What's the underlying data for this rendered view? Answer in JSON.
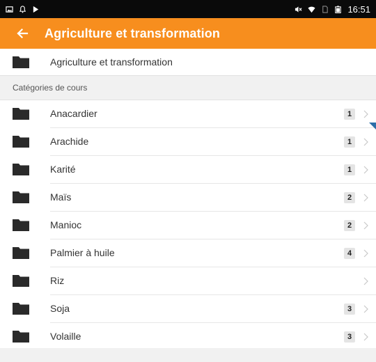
{
  "status_bar": {
    "time": "16:51",
    "icons": [
      "image-icon",
      "notification-icon",
      "play-store-icon",
      "volume-muted-icon",
      "wifi-icon",
      "sim-icon",
      "battery-icon"
    ]
  },
  "app_bar": {
    "title": "Agriculture et transformation",
    "back_icon": "arrow-left-icon",
    "background": "#f78e1e"
  },
  "parent_category": {
    "label": "Agriculture et transformation",
    "icon": "folder-icon"
  },
  "section": {
    "header": "Catégories de cours"
  },
  "categories": [
    {
      "label": "Anacardier",
      "count": "1"
    },
    {
      "label": "Arachide",
      "count": "1"
    },
    {
      "label": "Karité",
      "count": "1"
    },
    {
      "label": "Maïs",
      "count": "2"
    },
    {
      "label": "Manioc",
      "count": "2"
    },
    {
      "label": "Palmier à huile",
      "count": "4"
    },
    {
      "label": "Riz",
      "count": ""
    },
    {
      "label": "Soja",
      "count": "3"
    },
    {
      "label": "Volaille",
      "count": "3"
    }
  ]
}
